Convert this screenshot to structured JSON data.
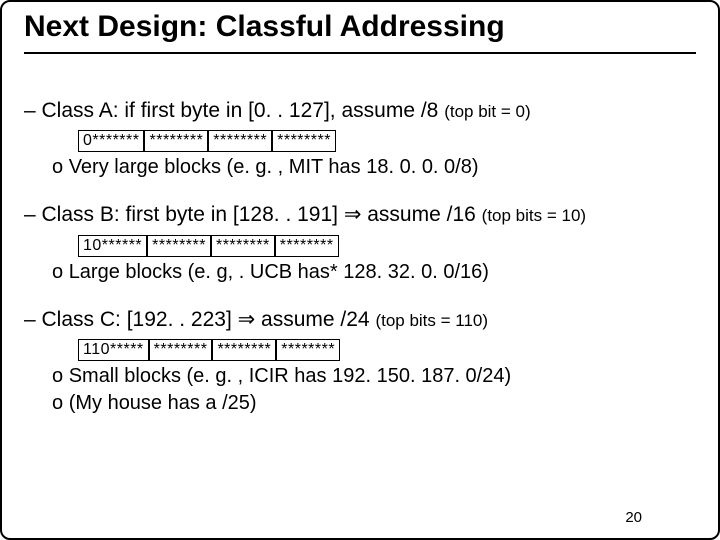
{
  "title": "Next Design: Classful Addressing",
  "classA": {
    "heading_pre": "– Class A: if first byte in [0. . 127], assume /8 ",
    "heading_sub": "(top bit = 0)",
    "bytes": [
      "0*******",
      "********",
      "********",
      "********"
    ],
    "bullets": [
      "Very large blocks (e. g. , MIT has 18. 0. 0. 0/8)"
    ]
  },
  "classB": {
    "heading_pre": "– Class B: first byte in [128. . 191] ⇒ assume /16 ",
    "heading_sub": "(top bits = 10)",
    "bytes": [
      "10******",
      "********",
      "********",
      "********"
    ],
    "bullets": [
      "Large blocks (e. g, . UCB has* 128. 32. 0. 0/16)"
    ]
  },
  "classC": {
    "heading_pre": "– Class C: [192. . 223] ⇒ assume /24   ",
    "heading_sub": "(top bits = 110)",
    "bytes": [
      "110*****",
      "********",
      "********",
      "********"
    ],
    "bullets": [
      "Small blocks (e. g. , ICIR has 192. 150. 187. 0/24)",
      "(My house has a /25)"
    ]
  },
  "page_number": "20"
}
